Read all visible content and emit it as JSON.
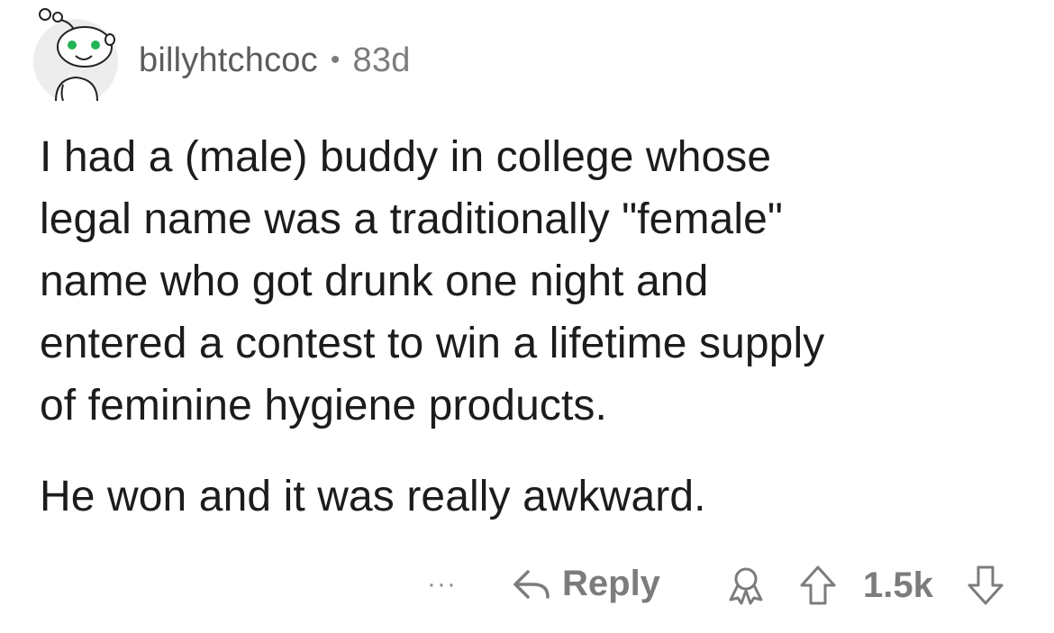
{
  "comment": {
    "author": "billyhtchcoc",
    "separator": "•",
    "age": "83d",
    "avatar_icon": "snoo-avatar-icon",
    "paragraphs": [
      "I had a (male) buddy in college whose\nlegal name was a traditionally \"female\"\nname who got drunk one night and\nentered a contest to win a lifetime supply\nof feminine hygiene products.",
      "He won and it was really awkward."
    ]
  },
  "actions": {
    "more_label": "···",
    "reply_label": "Reply",
    "score": "1.5k",
    "icons": {
      "reply": "reply-arrow-icon",
      "award": "award-icon",
      "upvote": "upvote-arrow-icon",
      "downvote": "downvote-arrow-icon"
    }
  },
  "colors": {
    "text": "#1c1c1c",
    "meta": "#7c7c7c",
    "avatar_eye": "#22b455",
    "background": "#ffffff"
  }
}
